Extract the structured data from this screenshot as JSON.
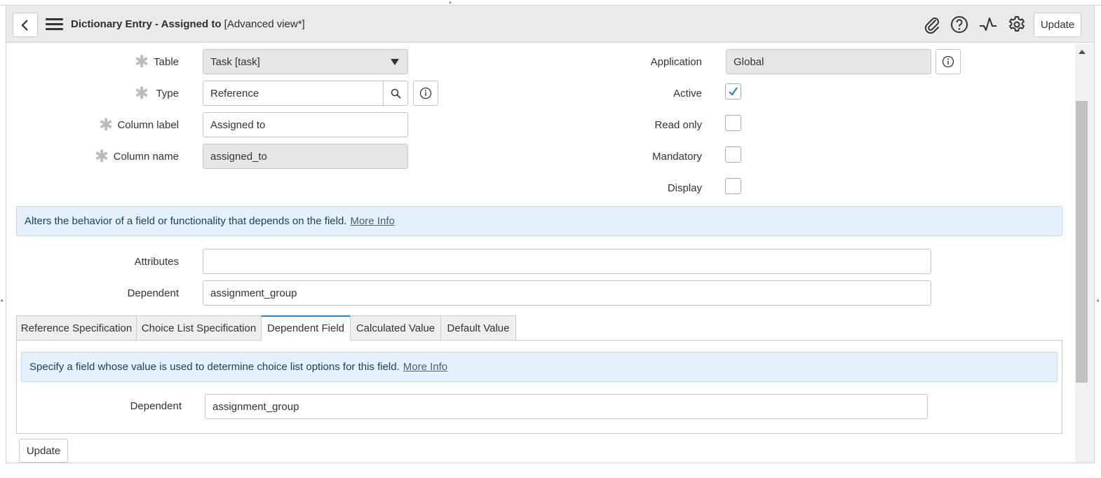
{
  "header": {
    "title_bold": "Dictionary Entry - Assigned to",
    "title_view": "[Advanced view*]",
    "update_label": "Update",
    "icons": [
      "back-icon",
      "menu-icon",
      "attachment-icon",
      "help-icon",
      "activity-icon",
      "settings-icon"
    ]
  },
  "form": {
    "table": {
      "label": "Table",
      "value": "Task [task]",
      "required": true
    },
    "type": {
      "label": "Type",
      "value": "Reference",
      "required": true
    },
    "column_label": {
      "label": "Column label",
      "value": "Assigned to",
      "required": true
    },
    "column_name": {
      "label": "Column name",
      "value": "assigned_to",
      "required": true
    },
    "application": {
      "label": "Application",
      "value": "Global"
    },
    "active": {
      "label": "Active",
      "checked": true
    },
    "read_only": {
      "label": "Read only",
      "checked": false
    },
    "mandatory": {
      "label": "Mandatory",
      "checked": false
    },
    "display": {
      "label": "Display",
      "checked": false
    },
    "info_text": "Alters the behavior of a field or functionality that depends on the field.",
    "info_link": "More Info",
    "attributes": {
      "label": "Attributes",
      "value": ""
    },
    "dependent": {
      "label": "Dependent",
      "value": "assignment_group"
    }
  },
  "tabs": [
    {
      "label": "Reference Specification",
      "active": false
    },
    {
      "label": "Choice List Specification",
      "active": false
    },
    {
      "label": "Dependent Field",
      "active": true
    },
    {
      "label": "Calculated Value",
      "active": false
    },
    {
      "label": "Default Value",
      "active": false
    }
  ],
  "tab_panel": {
    "info_text": "Specify a field whose value is used to determine choice list options for this field.",
    "info_link": "More Info",
    "dependent": {
      "label": "Dependent",
      "value": "assignment_group"
    }
  },
  "footer": {
    "update_label": "Update"
  },
  "colors": {
    "header_bg": "#e9ebeb",
    "info_bg": "#e4f0fb",
    "accent": "#2e84cd"
  }
}
